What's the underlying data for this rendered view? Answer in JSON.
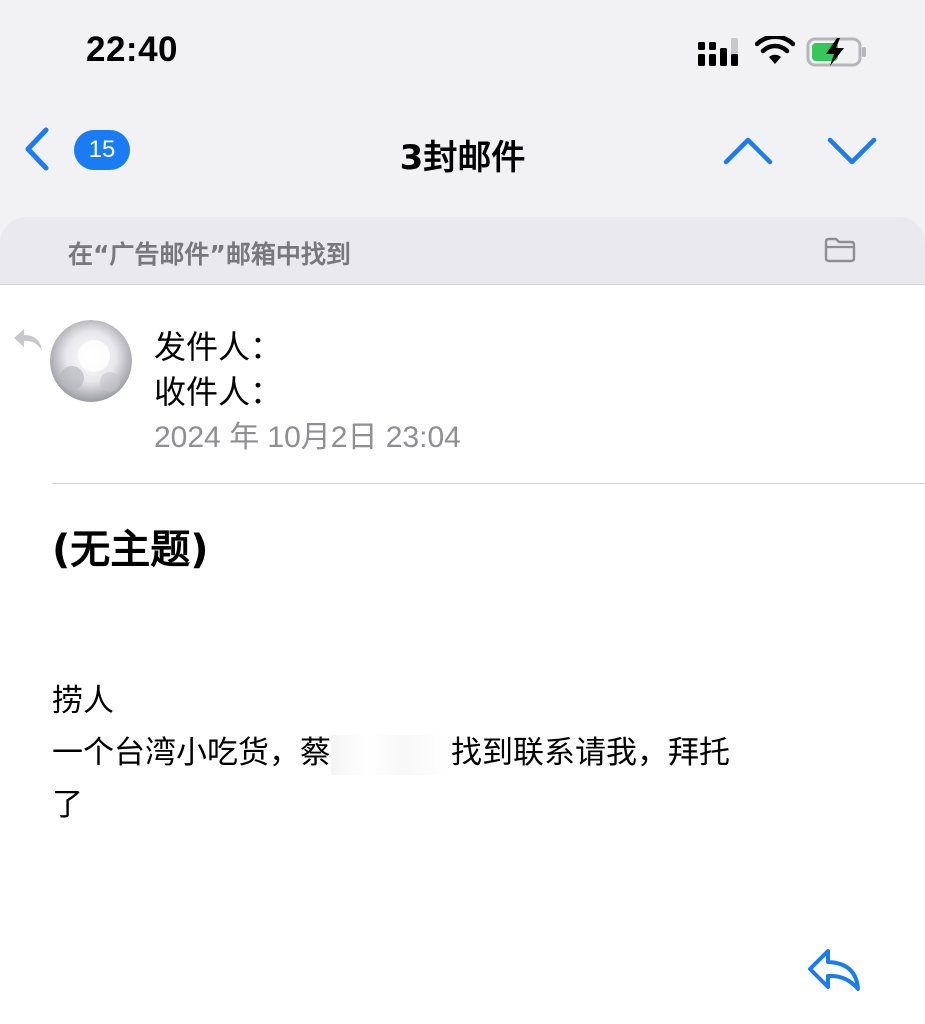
{
  "status_bar": {
    "time": "22:40",
    "icons": [
      "cellular-signal-icon",
      "wifi-icon",
      "battery-charging-icon"
    ]
  },
  "nav": {
    "back_icon": "chevron-left-icon",
    "unread_count": "15",
    "title": "3封邮件",
    "prev_icon": "chevron-up-icon",
    "next_icon": "chevron-down-icon",
    "accent_color": "#1a7cf5"
  },
  "banner": {
    "text": "在“广告邮件”邮箱中找到",
    "icon": "folder-icon"
  },
  "message": {
    "replied_icon": "reply-arrow-icon",
    "from_label": "发件人：",
    "to_label": "收件人：",
    "date": "2024 年 10月2日 23:04",
    "subject": "(无主题)",
    "body": {
      "line1": "捞人",
      "line2_before": "一个台湾小吃货，蔡",
      "line2_after": "找到联系请我，拜托",
      "line3": "了"
    },
    "reply_icon": "reply-icon"
  }
}
